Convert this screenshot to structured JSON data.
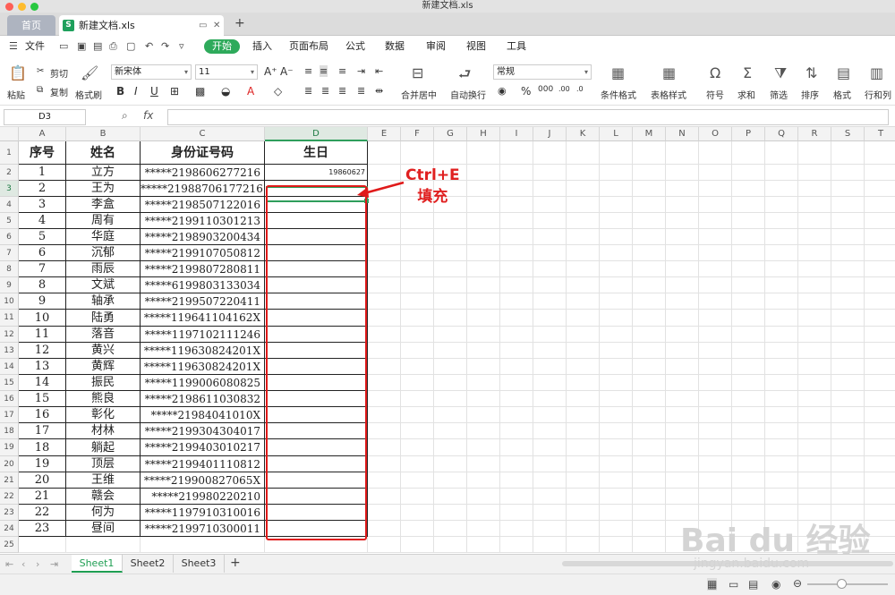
{
  "window": {
    "title": "新建文档.xls"
  },
  "tabs": {
    "home": "首页",
    "doc": "新建文档.xls",
    "add": "+"
  },
  "menu": {
    "file": "文件",
    "items": [
      "开始",
      "插入",
      "页面布局",
      "公式",
      "数据",
      "审阅",
      "视图",
      "工具"
    ]
  },
  "toolbar": {
    "paste": "粘贴",
    "cut": "剪切",
    "copy": "复制",
    "format_painter": "格式刷",
    "font_name": "新宋体",
    "font_size": "11",
    "merge": "合并居中",
    "wrap": "自动换行",
    "number_format": "常规",
    "cond_format": "条件格式",
    "table_style": "表格样式",
    "symbol": "符号",
    "sum": "求和",
    "filter": "筛选",
    "sort": "排序",
    "format": "格式",
    "rowcol": "行和列"
  },
  "formula": {
    "name_box": "D3",
    "fx": "fx",
    "content": ""
  },
  "columns": [
    "A",
    "B",
    "C",
    "D",
    "E",
    "F",
    "G",
    "H",
    "I",
    "J",
    "K",
    "L",
    "M",
    "N",
    "O",
    "P",
    "Q",
    "R",
    "S",
    "T"
  ],
  "rows": [
    "1",
    "2",
    "3",
    "4",
    "5",
    "6",
    "7",
    "8",
    "9",
    "10",
    "11",
    "12",
    "13",
    "14",
    "15",
    "16",
    "17",
    "18",
    "19",
    "20",
    "21",
    "22",
    "23",
    "24",
    "25"
  ],
  "table": {
    "headers": [
      "序号",
      "姓名",
      "身份证号码",
      "生日"
    ],
    "data": [
      [
        "1",
        "立方",
        "*****2198606277216",
        "19860627"
      ],
      [
        "2",
        "王为",
        "*****21988706177216",
        ""
      ],
      [
        "3",
        "李盒",
        "*****2198507122016",
        ""
      ],
      [
        "4",
        "周有",
        "*****2199110301213",
        ""
      ],
      [
        "5",
        "华庭",
        "*****2198903200434",
        ""
      ],
      [
        "6",
        "沉郁",
        "*****2199107050812",
        ""
      ],
      [
        "7",
        "雨辰",
        "*****2199807280811",
        ""
      ],
      [
        "8",
        "文斌",
        "*****6199803133034",
        ""
      ],
      [
        "9",
        "轴承",
        "*****2199507220411",
        ""
      ],
      [
        "10",
        "陆勇",
        "*****119641104162X",
        ""
      ],
      [
        "11",
        "落音",
        "*****1197102111246",
        ""
      ],
      [
        "12",
        "黄兴",
        "*****119630824201X",
        ""
      ],
      [
        "13",
        "黄辉",
        "*****119630824201X",
        ""
      ],
      [
        "14",
        "振民",
        "*****1199006080825",
        ""
      ],
      [
        "15",
        "熊良",
        "*****2198611030832",
        ""
      ],
      [
        "16",
        "彰化",
        "*****21984041010X",
        ""
      ],
      [
        "17",
        "材林",
        "*****2199304304017",
        ""
      ],
      [
        "18",
        "躺起",
        "*****2199403010217",
        ""
      ],
      [
        "19",
        "顶层",
        "*****2199401110812",
        ""
      ],
      [
        "20",
        "王维",
        "*****219900827065X",
        ""
      ],
      [
        "21",
        "赣会",
        "*****219980220210",
        ""
      ],
      [
        "22",
        "何为",
        "*****1197910310016",
        ""
      ],
      [
        "23",
        "昼间",
        "*****2199710300011",
        ""
      ]
    ]
  },
  "annotation": {
    "line1": "Ctrl+E",
    "line2": "填充"
  },
  "sheets": [
    "Sheet1",
    "Sheet2",
    "Sheet3"
  ],
  "watermark": {
    "main": "Bai du 经验",
    "sub": "jingyan.baidu.com"
  },
  "colors": {
    "accent": "#2eaa5b",
    "annotation": "#e01a1a"
  }
}
